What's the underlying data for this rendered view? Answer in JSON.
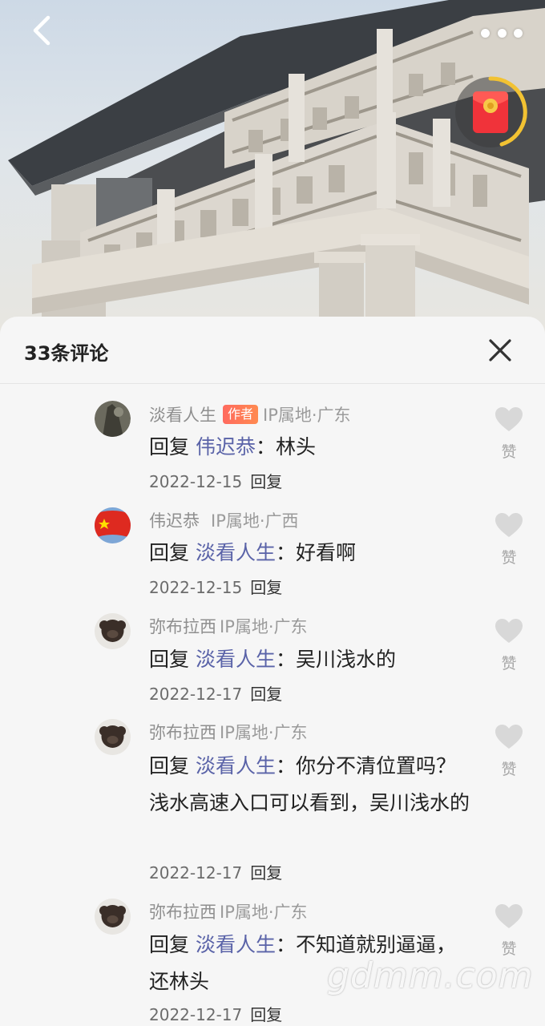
{
  "header": {
    "back_icon": "chevron-left-icon",
    "more_icon": "more-dots-icon",
    "redpacket_icon": "red-envelope-icon"
  },
  "sheet": {
    "title": "33条评论",
    "close_icon": "close-icon"
  },
  "comments": [
    {
      "name": "淡看人生",
      "badge": "作者",
      "ip": "IP属地·广东",
      "prefix": "回复",
      "mention": "伟迟恭",
      "text": "：林头",
      "date": "2022-12-15",
      "reply_label": "回复",
      "like_label": "赞"
    },
    {
      "name": "伟迟恭",
      "ip": "IP属地·广西",
      "prefix": "回复",
      "mention": "淡看人生",
      "text": "：好看啊",
      "date": "2022-12-15",
      "reply_label": "回复",
      "like_label": "赞"
    },
    {
      "name": "弥布拉西",
      "ip": "IP属地·广东",
      "prefix": "回复",
      "mention": "淡看人生",
      "text": "：吴川浅水的",
      "date": "2022-12-17",
      "reply_label": "回复",
      "like_label": "赞"
    },
    {
      "name": "弥布拉西",
      "ip": "IP属地·广东",
      "prefix": "回复",
      "mention": "淡看人生",
      "text": "：你分不清位置吗？浅水高速入口可以看到，吴川浅水的",
      "date": "2022-12-17",
      "reply_label": "回复",
      "like_label": "赞"
    },
    {
      "name": "弥布拉西",
      "ip": "IP属地·广东",
      "prefix": "回复",
      "mention": "淡看人生",
      "text": "：不知道就别逼逼，还林头",
      "date": "2022-12-17",
      "reply_label": "回复",
      "like_label": "赞"
    }
  ],
  "watermark": "gdmm.com"
}
